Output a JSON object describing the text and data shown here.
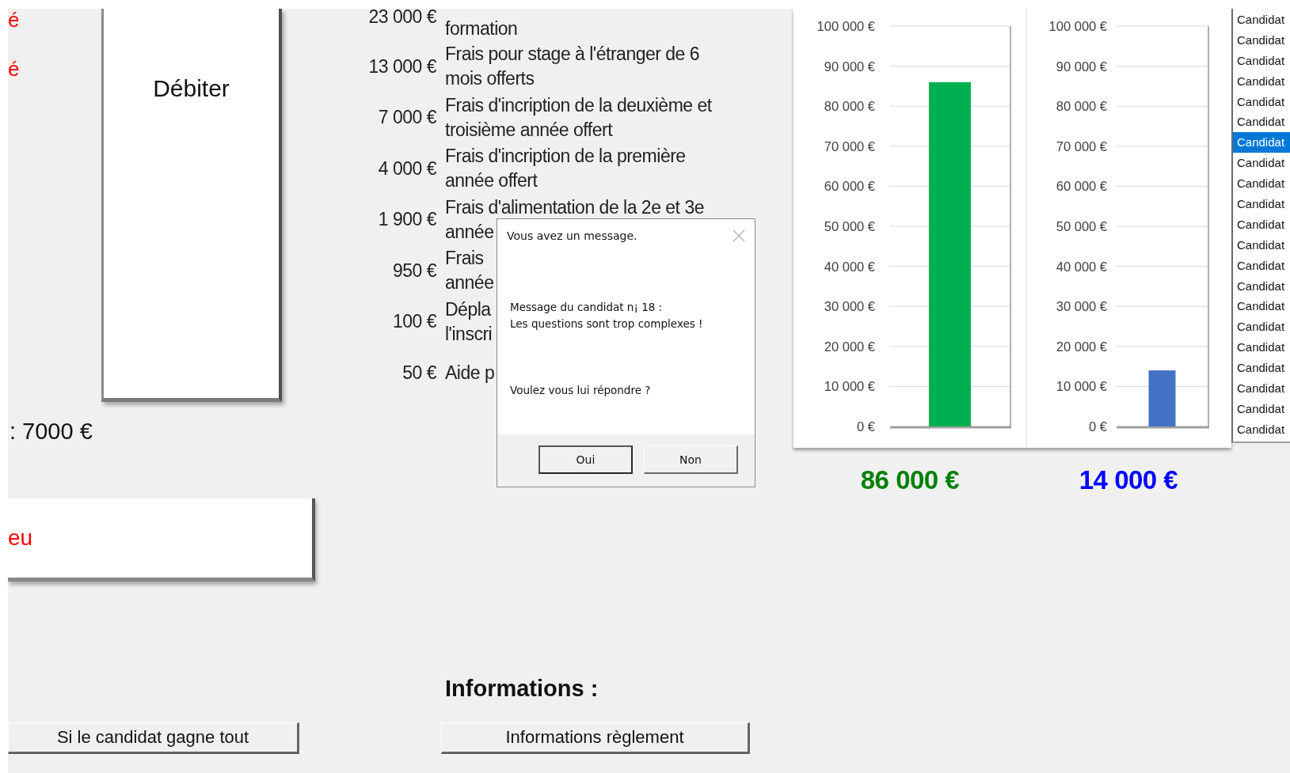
{
  "left_panel": {
    "red_letters": [
      "é",
      "é"
    ],
    "debit_button": "Débiter",
    "amount_label": ": 7000 €",
    "red_button": "eu",
    "win_all_button": "Si le candidat gagne tout"
  },
  "prize_list": [
    {
      "kind": "clipped",
      "amount": "23 000 €",
      "lines": [
        "formation"
      ]
    },
    {
      "kind": "full",
      "amount": "13 000 €",
      "lines": [
        "Frais pour stage à l'étranger de 6",
        "mois offerts"
      ]
    },
    {
      "kind": "full",
      "amount": "7 000 €",
      "lines": [
        "Frais d'incription de la deuxième et",
        "troisième année offert"
      ]
    },
    {
      "kind": "full",
      "amount": "4 000 €",
      "lines": [
        "Frais d'incription de la première",
        "année offert"
      ]
    },
    {
      "kind": "full",
      "amount": "1 900 €",
      "lines": [
        "Frais d'alimentation de la 2e et 3e",
        "année"
      ]
    },
    {
      "kind": "full",
      "amount": "950 €",
      "lines": [
        "Frais",
        "année"
      ]
    },
    {
      "kind": "full",
      "amount": "100 €",
      "lines": [
        "Dépla",
        "l'inscri"
      ]
    },
    {
      "kind": "full",
      "amount": "50 €",
      "lines": [
        "Aide p"
      ]
    }
  ],
  "informations": {
    "heading": "Informations :",
    "button": "Informations règlement"
  },
  "charts": [
    {
      "total": "86 000 €",
      "color": "#008000",
      "chart_data": {
        "type": "bar",
        "grid": true,
        "ylim": [
          0,
          100000
        ],
        "yticks": [
          {
            "value": 0,
            "label": "0 €"
          },
          {
            "value": 10000,
            "label": "10 000 €"
          },
          {
            "value": 20000,
            "label": "20 000 €"
          },
          {
            "value": 30000,
            "label": "30 000 €"
          },
          {
            "value": 40000,
            "label": "40 000 €"
          },
          {
            "value": 50000,
            "label": "50 000 €"
          },
          {
            "value": 60000,
            "label": "60 000 €"
          },
          {
            "value": 70000,
            "label": "70 000 €"
          },
          {
            "value": 80000,
            "label": "80 000 €"
          },
          {
            "value": 90000,
            "label": "90 000 €"
          },
          {
            "value": 100000,
            "label": "100 000 €"
          }
        ],
        "series": [
          {
            "color": "#00b050",
            "values": [
              86000
            ]
          }
        ]
      }
    },
    {
      "total": "14 000 €",
      "color": "#0000ff",
      "chart_data": {
        "type": "bar",
        "grid": true,
        "ylim": [
          0,
          100000
        ],
        "yticks": [
          {
            "value": 0,
            "label": "0 €"
          },
          {
            "value": 10000,
            "label": "10 000 €"
          },
          {
            "value": 20000,
            "label": "20 000 €"
          },
          {
            "value": 30000,
            "label": "30 000 €"
          },
          {
            "value": 40000,
            "label": "40 000 €"
          },
          {
            "value": 50000,
            "label": "50 000 €"
          },
          {
            "value": 60000,
            "label": "60 000 €"
          },
          {
            "value": 70000,
            "label": "70 000 €"
          },
          {
            "value": 80000,
            "label": "80 000 €"
          },
          {
            "value": 90000,
            "label": "90 000 €"
          },
          {
            "value": 100000,
            "label": "100 000 €"
          }
        ],
        "series": [
          {
            "color": "#4472c4",
            "values": [
              14000
            ]
          }
        ]
      }
    }
  ],
  "candidate_list": [
    {
      "label": "Candidat",
      "selected": false
    },
    {
      "label": "Candidat",
      "selected": false
    },
    {
      "label": "Candidat",
      "selected": false
    },
    {
      "label": "Candidat",
      "selected": false
    },
    {
      "label": "Candidat",
      "selected": false
    },
    {
      "label": "Candidat",
      "selected": false
    },
    {
      "label": "Candidat",
      "selected": true
    },
    {
      "label": "Candidat",
      "selected": false
    },
    {
      "label": "Candidat",
      "selected": false
    },
    {
      "label": "Candidat",
      "selected": false
    },
    {
      "label": "Candidat",
      "selected": false
    },
    {
      "label": "Candidat",
      "selected": false
    },
    {
      "label": "Candidat",
      "selected": false
    },
    {
      "label": "Candidat",
      "selected": false
    },
    {
      "label": "Candidat",
      "selected": false
    },
    {
      "label": "Candidat",
      "selected": false
    },
    {
      "label": "Candidat",
      "selected": false
    },
    {
      "label": "Candidat",
      "selected": false
    },
    {
      "label": "Candidat",
      "selected": false
    },
    {
      "label": "Candidat",
      "selected": false
    },
    {
      "label": "Candidat",
      "selected": false
    }
  ],
  "dialog": {
    "title": "Vous avez un message.",
    "message_lines": [
      "Message du candidat n¡ 18 :",
      "Les questions sont trop complexes !"
    ],
    "question": "Voulez vous lui répondre ?",
    "buttons": [
      {
        "label": "Oui",
        "default": true
      },
      {
        "label": "Non",
        "default": false
      }
    ]
  }
}
